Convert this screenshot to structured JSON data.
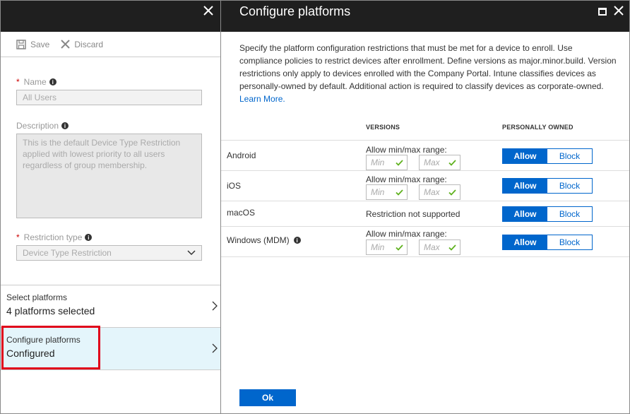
{
  "left": {
    "toolbar": {
      "save": "Save",
      "discard": "Discard"
    },
    "name": {
      "label": "Name",
      "value": "All Users"
    },
    "description": {
      "label": "Description",
      "value": "This is the default Device Type Restriction applied with lowest priority to all users regardless of group membership."
    },
    "restriction_type": {
      "label": "Restriction type",
      "value": "Device Type Restriction"
    },
    "nav": [
      {
        "title": "Select platforms",
        "subtitle": "4 platforms selected"
      },
      {
        "title": "Configure platforms",
        "subtitle": "Configured"
      }
    ]
  },
  "right": {
    "title": "Configure platforms",
    "description": "Specify the platform configuration restrictions that must be met for a device to enroll. Use compliance policies to restrict devices after enrollment. Define versions as major.minor.build. Version restrictions only apply to devices enrolled with the Company Portal. Intune classifies devices as personally-owned by default. Additional action is required to classify devices as corporate-owned.",
    "learn_more": "Learn More.",
    "columns": {
      "versions": "VERSIONS",
      "personally_owned": "PERSONALLY OWNED"
    },
    "range_label": "Allow min/max range:",
    "min_placeholder": "Min",
    "max_placeholder": "Max",
    "allow": "Allow",
    "block": "Block",
    "rows": [
      {
        "platform": "Android",
        "versions": "range"
      },
      {
        "platform": "iOS",
        "versions": "range"
      },
      {
        "platform": "macOS",
        "versions": "Restriction not supported"
      },
      {
        "platform": "Windows (MDM)",
        "versions": "range"
      }
    ],
    "ok": "Ok"
  },
  "colors": {
    "accent": "#0066cc",
    "header": "#1f1f1f",
    "highlight": "#e0001a",
    "active_nav": "#e4f5fb"
  }
}
